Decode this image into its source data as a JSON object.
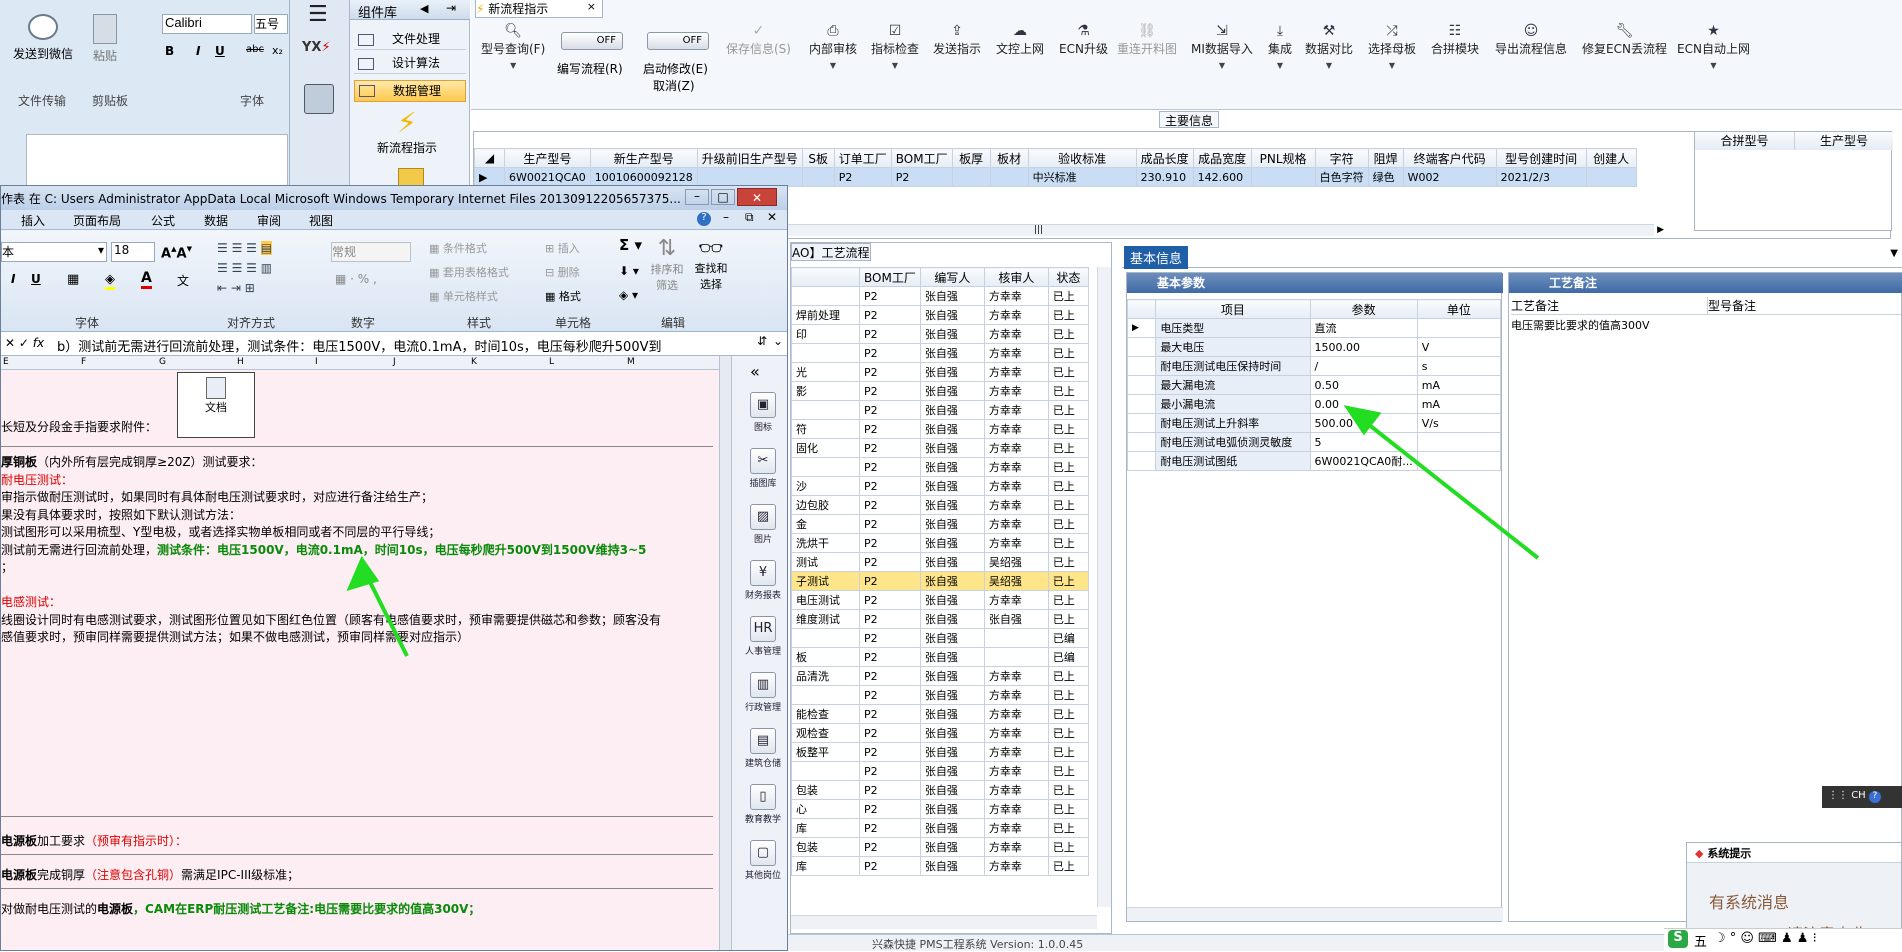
{
  "word": {
    "send_wechat": "发送到微信",
    "paste": "粘贴",
    "font_name": "Calibri",
    "font_size": "五号",
    "group_file": "文件传输",
    "group_clip": "剪贴板",
    "group_font": "字体",
    "bold": "B",
    "italic": "I",
    "underline": "U",
    "strike": "abc",
    "sub": "x₂"
  },
  "module": {
    "header": "组件库",
    "items": [
      "文件处理",
      "设计算法",
      "数据管理"
    ],
    "new_flow": "新流程指示"
  },
  "toolbar": {
    "tab_title": "新流程指示",
    "buttons": [
      "型号查询(F)",
      "编写流程(R)",
      "启动修改(E)",
      "保存信息(S)",
      "内部审核",
      "指标检查",
      "发送指示",
      "文控上网",
      "ECN升级",
      "重连开料图",
      "MI数据导入",
      "集成",
      "数据对比",
      "选择母板",
      "合拼模块",
      "导出流程信息",
      "修复ECN丢流程",
      "ECN自动上网"
    ],
    "toggle_off": "OFF",
    "cancel": "取消(Z)"
  },
  "main_info": {
    "title": "主要信息",
    "columns": [
      "生产型号",
      "新生产型号",
      "升级前旧生产型号",
      "S板",
      "订单工厂",
      "BOM工厂",
      "板厚",
      "板材",
      "验收标准",
      "成品长度",
      "成品宽度",
      "PNL规格",
      "字符",
      "阻焊",
      "终端客户代码",
      "型号创建时间",
      "创建人"
    ],
    "row": [
      "6W0021QCA0",
      "10010600092128",
      "",
      "",
      "P2",
      "P2",
      "",
      "",
      "中兴标准",
      "230.910",
      "142.600",
      "",
      "白色字符",
      "绿色",
      "W002",
      "2021/2/3",
      ""
    ],
    "merge_cols": [
      "合拼型号",
      "生产型号"
    ]
  },
  "excel": {
    "title": "作表 在 C: Users Administrator AppData Local Microsoft Windows Temporary Internet Files 20130912205657375...",
    "tabs": [
      "插入",
      "页面布局",
      "公式",
      "数据",
      "审阅",
      "视图"
    ],
    "font_size": "18",
    "number_format": "常规",
    "groups": [
      "字体",
      "对齐方式",
      "数字",
      "样式",
      "单元格",
      "编辑"
    ],
    "style_items": [
      "条件格式",
      "套用表格格式",
      "单元格样式"
    ],
    "cell_items": [
      "插入",
      "删除",
      "格式"
    ],
    "edit_items": [
      "排序和筛选",
      "查找和选择"
    ],
    "formula": "b）测试前无需进行回流前处理，测试条件：电压1500V，电流0.1mA，时间10s，电压每秒爬升500V到",
    "col_letters": [
      "E",
      "F",
      "G",
      "H",
      "I",
      "J",
      "K",
      "L",
      "M"
    ],
    "attach_label": "长短及分段金手指要求附件：",
    "attach_icon": "文档",
    "lines": [
      {
        "t": "厚铜板",
        "s": "（内外所有层完成铜厚≥20Z）测试要求：",
        "c": "#000",
        "b": true
      },
      {
        "t": "耐电压测试：",
        "c": "#d00"
      },
      {
        "t": "审指示做耐压测试时，如果同时有具体耐电压测试要求时，对应进行备注给生产；",
        "c": "#000"
      },
      {
        "t": "果没有具体要求时，按照如下默认测试方法：",
        "c": "#000"
      },
      {
        "t": "测试图形可以采用梳型、Y型电极，或者选择实物单板相同或者不同层的平行导线；",
        "c": "#000"
      },
      {
        "t": "测试前无需进行回流前处理，",
        "s": "测试条件：电压1500V，电流0.1mA，时间10s，电压每秒爬升500V到1500V维持3~5",
        "c": "#000",
        "sc": "#0a8a0a"
      },
      {
        "t": "；",
        "c": "#000"
      },
      {
        "t": "",
        "c": "#000"
      },
      {
        "t": "电感测试：",
        "c": "#d00"
      },
      {
        "t": "线圈设计同时有电感测试要求，测试图形位置见如下图红色位置（顾客有电感值要求时，预审需要提供磁芯和参数；顾客没有",
        "c": "#000"
      },
      {
        "t": "感值要求时，预审同样需要提供测试方法；如果不做电感测试，预审同样需要对应指示）",
        "c": "#000"
      }
    ],
    "power1_a": "电源板",
    "power1_b": "加工要求",
    "power1_c": "（预审有指示时）：",
    "power2_a": "电源板",
    "power2_b": "完成铜厚",
    "power2_c": "（注意包含孔铜）",
    "power2_d": "需满足IPC-III级标准；",
    "power3_a": "对做耐电压测试的",
    "power3_b": "电源板",
    "power3_c": "，CAM在ERP耐压测试工艺备注:电压需要比要求的值高300V；"
  },
  "sidebar_v": {
    "items": [
      "图标",
      "插图库",
      "图片",
      "财务报表",
      "人事管理",
      "行政管理",
      "建筑仓储",
      "教育教学",
      "其他岗位"
    ]
  },
  "process": {
    "tab": "AO】工艺流程",
    "columns": [
      "BOM工厂",
      "编写人",
      "核审人",
      "状态"
    ],
    "names": [
      "",
      "焊前处理",
      "印",
      "",
      "光",
      "影",
      "",
      "符",
      "固化",
      "",
      "沙",
      "边包胶",
      "金",
      "洗烘干",
      "测试",
      "子测试",
      "电压测试",
      "维度测试",
      "",
      "板",
      "品清洗",
      "",
      "能检查",
      "观检查",
      "板整平",
      "",
      "包装",
      "心",
      "库",
      "包装",
      "库"
    ],
    "rows": [
      [
        "P2",
        "张自强",
        "方幸幸",
        "已上"
      ],
      [
        "P2",
        "张自强",
        "方幸幸",
        "已上"
      ],
      [
        "P2",
        "张自强",
        "方幸幸",
        "已上"
      ],
      [
        "P2",
        "张自强",
        "方幸幸",
        "已上"
      ],
      [
        "P2",
        "张自强",
        "方幸幸",
        "已上"
      ],
      [
        "P2",
        "张自强",
        "方幸幸",
        "已上"
      ],
      [
        "P2",
        "张自强",
        "方幸幸",
        "已上"
      ],
      [
        "P2",
        "张自强",
        "方幸幸",
        "已上"
      ],
      [
        "P2",
        "张自强",
        "方幸幸",
        "已上"
      ],
      [
        "P2",
        "张自强",
        "方幸幸",
        "已上"
      ],
      [
        "P2",
        "张自强",
        "方幸幸",
        "已上"
      ],
      [
        "P2",
        "张自强",
        "方幸幸",
        "已上"
      ],
      [
        "P2",
        "张自强",
        "方幸幸",
        "已上"
      ],
      [
        "P2",
        "张自强",
        "方幸幸",
        "已上"
      ],
      [
        "P2",
        "张自强",
        "吴绍强",
        "已上"
      ],
      [
        "P2",
        "张自强",
        "吴绍强",
        "已上"
      ],
      [
        "P2",
        "张自强",
        "方幸幸",
        "已上"
      ],
      [
        "P2",
        "张自强",
        "张自强",
        "已上"
      ],
      [
        "P2",
        "张自强",
        "",
        "已编"
      ],
      [
        "P2",
        "张自强",
        "",
        "已编"
      ],
      [
        "P2",
        "张自强",
        "方幸幸",
        "已上"
      ],
      [
        "P2",
        "张自强",
        "方幸幸",
        "已上"
      ],
      [
        "P2",
        "张自强",
        "方幸幸",
        "已上"
      ],
      [
        "P2",
        "张自强",
        "方幸幸",
        "已上"
      ],
      [
        "P2",
        "张自强",
        "方幸幸",
        "已上"
      ],
      [
        "P2",
        "张自强",
        "方幸幸",
        "已上"
      ],
      [
        "P2",
        "张自强",
        "方幸幸",
        "已上"
      ],
      [
        "P2",
        "张自强",
        "方幸幸",
        "已上"
      ],
      [
        "P2",
        "张自强",
        "方幸幸",
        "已上"
      ],
      [
        "P2",
        "张自强",
        "方幸幸",
        "已上"
      ],
      [
        "P2",
        "张自强",
        "方幸幸",
        "已上"
      ]
    ]
  },
  "basic": {
    "title": "基本信息",
    "tab": "基本参数",
    "columns": [
      "项目",
      "参数",
      "单位"
    ],
    "rows": [
      [
        "电压类型",
        "直流",
        ""
      ],
      [
        "最大电压",
        "1500.00",
        "V"
      ],
      [
        "耐电压测试电压保持时间",
        "/",
        "s"
      ],
      [
        "最大漏电流",
        "0.50",
        "mA"
      ],
      [
        "最小漏电流",
        "0.00",
        "mA"
      ],
      [
        "耐电压测试上升斜率",
        "500.00",
        "V/s"
      ],
      [
        "耐电压测试电弧侦测灵敏度",
        "5",
        ""
      ],
      [
        "耐电压测试图纸",
        "6W0021QCA0耐...",
        ""
      ]
    ]
  },
  "remark": {
    "tab": "工艺备注",
    "col1": "工艺备注",
    "col2": "型号备注",
    "text": "电压需要比要求的值高300V"
  },
  "status": {
    "text": "兴森快捷 PMS工程系统 Version: 1.0.0.45"
  },
  "tray": {
    "title": "系统提示",
    "msg": "有系统消息",
    "msg2": "请注意查收!",
    "ime": "CH",
    "ime2": "五"
  },
  "colors": {
    "accent": "#1f5fa8",
    "arrow": "#22dd22",
    "highlight": "#ffe58a"
  }
}
